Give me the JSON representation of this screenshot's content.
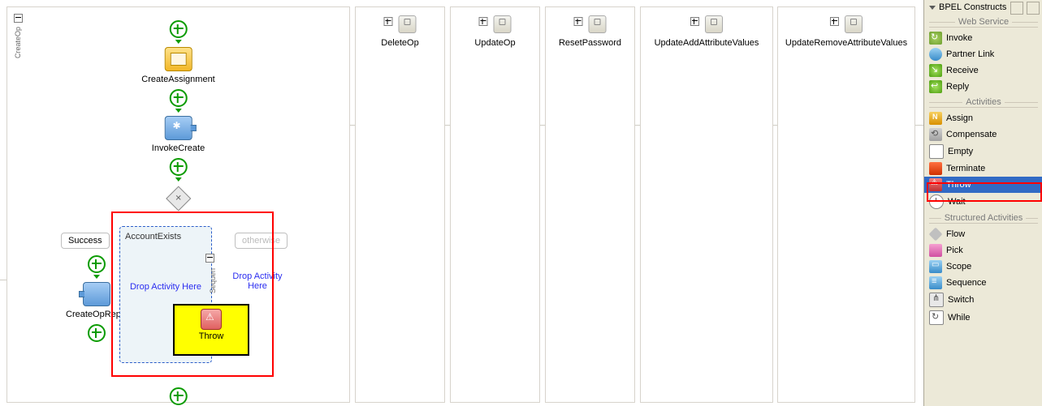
{
  "canvas": {
    "main_side_label": "CreateOp",
    "main": {
      "assign_label": "CreateAssignment",
      "invoke_label": "InvokeCreate",
      "success_chip": "Success",
      "otherwise_chip": "otherwise",
      "account_exists_title": "AccountExists",
      "drop_here": "Drop Activity Here",
      "drop_here_right": "Drop Activity Here",
      "sequence_side": "Sequen",
      "reply_label": "CreateOpReply",
      "drag_throw_label": "Throw"
    },
    "branches": [
      "DeleteOp",
      "UpdateOp",
      "ResetPassword",
      "UpdateAddAttributeValues",
      "UpdateRemoveAttributeValues"
    ]
  },
  "palette": {
    "title": "BPEL Constructs",
    "groups": {
      "web_service": {
        "label": "Web Service",
        "items": [
          "Invoke",
          "Partner Link",
          "Receive",
          "Reply"
        ]
      },
      "activities": {
        "label": "Activities",
        "items": [
          "Assign",
          "Compensate",
          "Empty",
          "Terminate",
          "Throw",
          "Wait"
        ],
        "selected": "Throw"
      },
      "structured": {
        "label": "Structured Activities",
        "items": [
          "Flow",
          "Pick",
          "Scope",
          "Sequence",
          "Switch",
          "While"
        ]
      }
    }
  }
}
